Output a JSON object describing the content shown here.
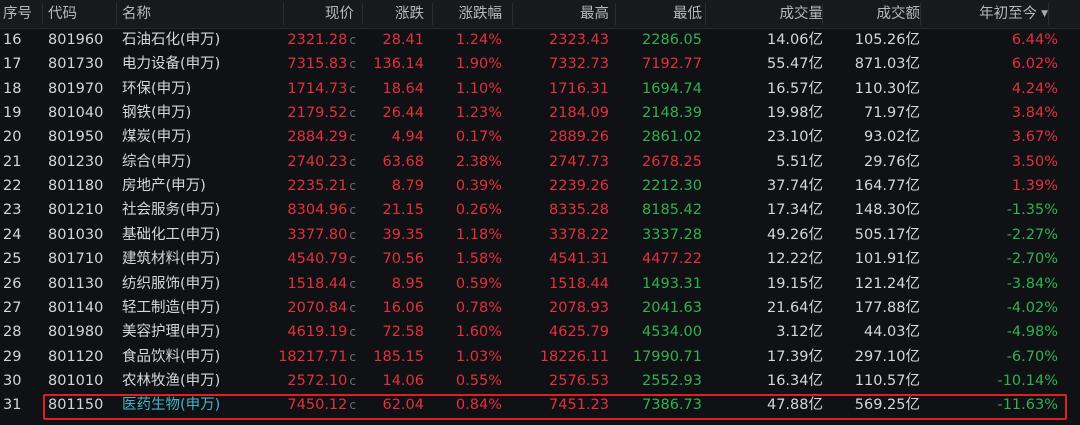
{
  "colors": {
    "up": "#e3303c",
    "down": "#2fb24e",
    "highlight_name": "#3cb6c6",
    "highlight_border": "#e02020"
  },
  "header": {
    "seq": "序号",
    "code": "代码",
    "name": "名称",
    "price": "现价",
    "change": "涨跌",
    "pct": "涨跌幅",
    "high": "最高",
    "low": "最低",
    "volume": "成交量",
    "amount": "成交额",
    "ytd": "年初至今",
    "sort_icon": "triangle-down"
  },
  "price_suffix": "c",
  "rows": [
    {
      "seq": "16",
      "code": "801960",
      "name": "石油石化(申万)",
      "price": "2321.28",
      "change": "28.41",
      "pct": "1.24%",
      "high": "2323.43",
      "low": "2286.05",
      "low_dir": "down",
      "volume": "14.06亿",
      "amount": "105.26亿",
      "ytd": "6.44%"
    },
    {
      "seq": "17",
      "code": "801730",
      "name": "电力设备(申万)",
      "price": "7315.83",
      "change": "136.14",
      "pct": "1.90%",
      "high": "7332.73",
      "low": "7192.77",
      "low_dir": "up",
      "volume": "55.47亿",
      "amount": "871.03亿",
      "ytd": "6.02%"
    },
    {
      "seq": "18",
      "code": "801970",
      "name": "环保(申万)",
      "price": "1714.73",
      "change": "18.64",
      "pct": "1.10%",
      "high": "1716.31",
      "low": "1694.74",
      "low_dir": "down",
      "volume": "16.57亿",
      "amount": "110.30亿",
      "ytd": "4.24%"
    },
    {
      "seq": "19",
      "code": "801040",
      "name": "钢铁(申万)",
      "price": "2179.52",
      "change": "26.44",
      "pct": "1.23%",
      "high": "2184.09",
      "low": "2148.39",
      "low_dir": "down",
      "volume": "19.98亿",
      "amount": "71.97亿",
      "ytd": "3.84%"
    },
    {
      "seq": "20",
      "code": "801950",
      "name": "煤炭(申万)",
      "price": "2884.29",
      "change": "4.94",
      "pct": "0.17%",
      "high": "2889.26",
      "low": "2861.02",
      "low_dir": "down",
      "volume": "23.10亿",
      "amount": "93.02亿",
      "ytd": "3.67%"
    },
    {
      "seq": "21",
      "code": "801230",
      "name": "综合(申万)",
      "price": "2740.23",
      "change": "63.68",
      "pct": "2.38%",
      "high": "2747.73",
      "low": "2678.25",
      "low_dir": "up",
      "volume": "5.51亿",
      "amount": "29.76亿",
      "ytd": "3.50%"
    },
    {
      "seq": "22",
      "code": "801180",
      "name": "房地产(申万)",
      "price": "2235.21",
      "change": "8.79",
      "pct": "0.39%",
      "high": "2239.26",
      "low": "2212.30",
      "low_dir": "down",
      "volume": "37.74亿",
      "amount": "164.77亿",
      "ytd": "1.39%"
    },
    {
      "seq": "23",
      "code": "801210",
      "name": "社会服务(申万)",
      "price": "8304.96",
      "change": "21.15",
      "pct": "0.26%",
      "high": "8335.28",
      "low": "8185.42",
      "low_dir": "down",
      "volume": "17.34亿",
      "amount": "148.30亿",
      "ytd": "-1.35%"
    },
    {
      "seq": "24",
      "code": "801030",
      "name": "基础化工(申万)",
      "price": "3377.80",
      "change": "39.35",
      "pct": "1.18%",
      "high": "3378.22",
      "low": "3337.28",
      "low_dir": "down",
      "volume": "49.26亿",
      "amount": "505.17亿",
      "ytd": "-2.27%"
    },
    {
      "seq": "25",
      "code": "801710",
      "name": "建筑材料(申万)",
      "price": "4540.79",
      "change": "70.56",
      "pct": "1.58%",
      "high": "4541.31",
      "low": "4477.22",
      "low_dir": "up",
      "volume": "12.22亿",
      "amount": "101.91亿",
      "ytd": "-2.70%"
    },
    {
      "seq": "26",
      "code": "801130",
      "name": "纺织服饰(申万)",
      "price": "1518.44",
      "change": "8.95",
      "pct": "0.59%",
      "high": "1518.44",
      "low": "1493.31",
      "low_dir": "down",
      "volume": "19.15亿",
      "amount": "121.24亿",
      "ytd": "-3.84%"
    },
    {
      "seq": "27",
      "code": "801140",
      "name": "轻工制造(申万)",
      "price": "2070.84",
      "change": "16.06",
      "pct": "0.78%",
      "high": "2078.93",
      "low": "2041.63",
      "low_dir": "down",
      "volume": "21.64亿",
      "amount": "177.88亿",
      "ytd": "-4.02%"
    },
    {
      "seq": "28",
      "code": "801980",
      "name": "美容护理(申万)",
      "price": "4619.19",
      "change": "72.58",
      "pct": "1.60%",
      "high": "4625.79",
      "low": "4534.00",
      "low_dir": "down",
      "volume": "3.12亿",
      "amount": "44.03亿",
      "ytd": "-4.98%"
    },
    {
      "seq": "29",
      "code": "801120",
      "name": "食品饮料(申万)",
      "price": "18217.71",
      "change": "185.15",
      "pct": "1.03%",
      "high": "18226.11",
      "low": "17990.71",
      "low_dir": "down",
      "volume": "17.39亿",
      "amount": "297.10亿",
      "ytd": "-6.70%"
    },
    {
      "seq": "30",
      "code": "801010",
      "name": "农林牧渔(申万)",
      "price": "2572.10",
      "change": "14.06",
      "pct": "0.55%",
      "high": "2576.53",
      "low": "2552.93",
      "low_dir": "down",
      "volume": "16.34亿",
      "amount": "110.57亿",
      "ytd": "-10.14%"
    },
    {
      "seq": "31",
      "code": "801150",
      "name": "医药生物(申万)",
      "price": "7450.12",
      "change": "62.04",
      "pct": "0.84%",
      "high": "7451.23",
      "low": "7386.73",
      "low_dir": "down",
      "volume": "47.88亿",
      "amount": "569.25亿",
      "ytd": "-11.63%",
      "highlighted": true
    }
  ]
}
